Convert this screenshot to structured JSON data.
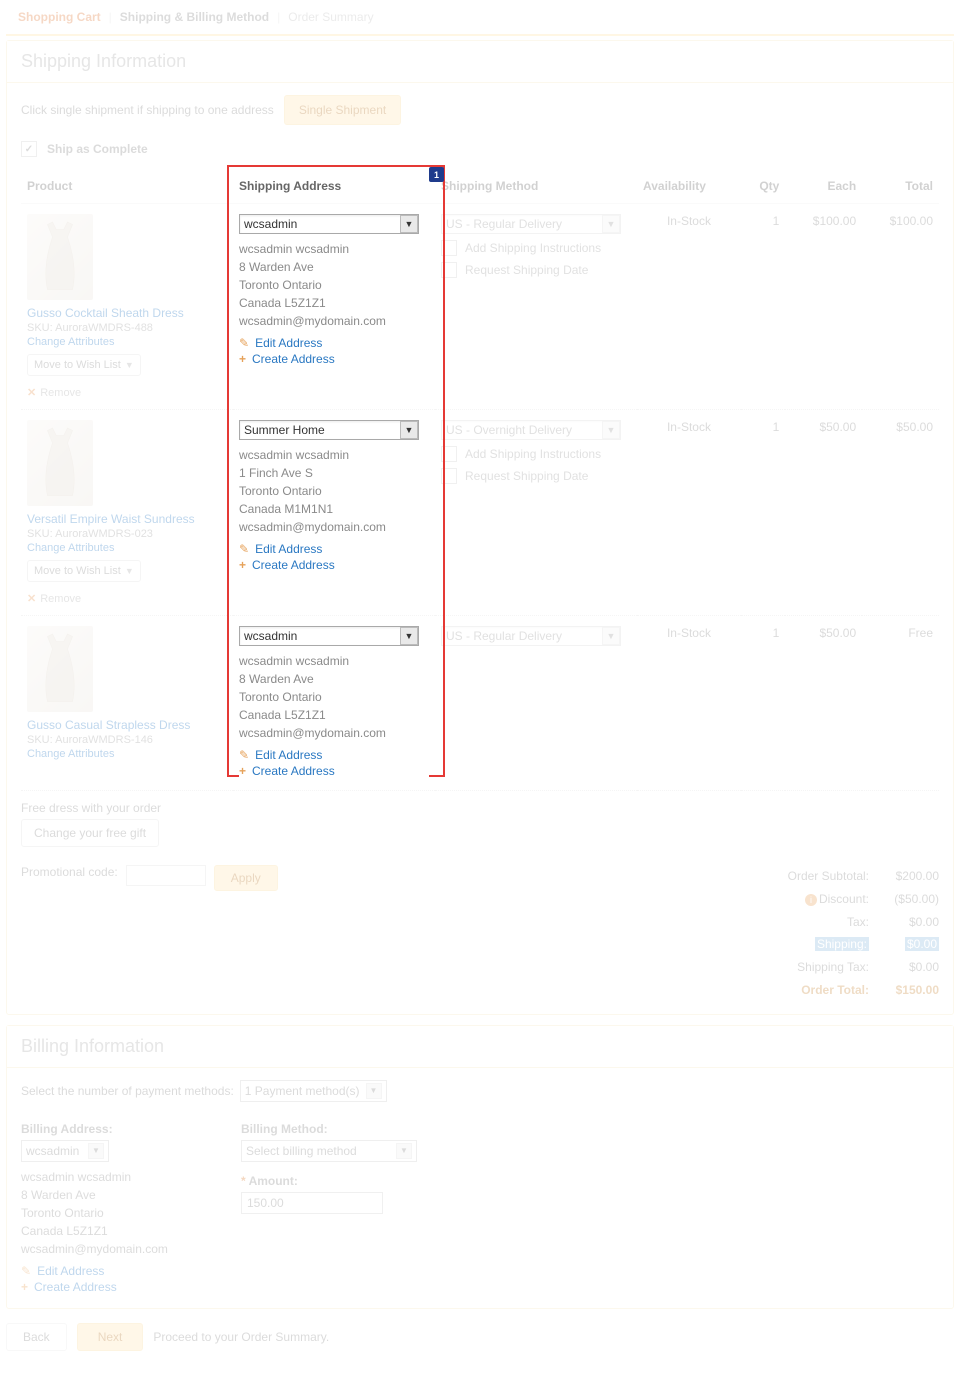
{
  "breadcrumbs": {
    "cart": "Shopping Cart",
    "ship": "Shipping & Billing Method",
    "summary": "Order Summary"
  },
  "shipping_info_header": "Shipping Information",
  "single_ship_hint": "Click single shipment if shipping to one address",
  "single_ship_btn": "Single Shipment",
  "ship_complete_label": "Ship as Complete",
  "cols": {
    "product": "Product",
    "addr": "Shipping Address",
    "method": "Shipping Method",
    "avail": "Availability",
    "qty": "Qty",
    "each": "Each",
    "total": "Total"
  },
  "remove_label": "Remove",
  "wish_label": "Move to Wish List",
  "edit_addr": "Edit Address",
  "create_addr": "Create Address",
  "add_instr": "Add Shipping Instructions",
  "req_date": "Request Shipping Date",
  "change_attr": "Change Attributes",
  "rows": [
    {
      "name": "Gusso Cocktail Sheath Dress",
      "sku": "SKU: AuroraWMDRS-488",
      "addr_sel": "wcsadmin",
      "addr": [
        "wcsadmin wcsadmin",
        "8 Warden Ave",
        "Toronto Ontario",
        "Canada L5Z1Z1",
        "wcsadmin@mydomain.com"
      ],
      "method": "US - Regular Delivery",
      "avail": "In-Stock",
      "qty": "1",
      "each": "$100.00",
      "total": "$100.00",
      "wish": true
    },
    {
      "name": "Versatil Empire Waist Sundress",
      "sku": "SKU: AuroraWMDRS-023",
      "addr_sel": "Summer Home",
      "addr": [
        "wcsadmin wcsadmin",
        "1 Finch Ave S",
        "Toronto Ontario",
        "Canada M1M1N1",
        "wcsadmin@mydomain.com"
      ],
      "method": "US - Overnight Delivery",
      "avail": "In-Stock",
      "qty": "1",
      "each": "$50.00",
      "total": "$50.00",
      "wish": true
    },
    {
      "name": "Gusso Casual Strapless Dress",
      "sku": "SKU: AuroraWMDRS-146",
      "addr_sel": "wcsadmin",
      "addr": [
        "wcsadmin wcsadmin",
        "8 Warden Ave",
        "Toronto Ontario",
        "Canada L5Z1Z1",
        "wcsadmin@mydomain.com"
      ],
      "method": "US - Regular Delivery",
      "avail": "In-Stock",
      "qty": "1",
      "each": "$50.00",
      "total": "Free",
      "wish": false
    }
  ],
  "free_gift": {
    "label": "Free dress with your order",
    "btn": "Change your free gift"
  },
  "promo": {
    "label": "Promotional code:",
    "apply": "Apply"
  },
  "totals": {
    "subtotal_l": "Order Subtotal:",
    "subtotal_v": "$200.00",
    "discount_l": "Discount:",
    "discount_v": "($50.00)",
    "tax_l": "Tax:",
    "tax_v": "$0.00",
    "ship_l": "Shipping:",
    "ship_v": "$0.00",
    "shiptax_l": "Shipping Tax:",
    "shiptax_v": "$0.00",
    "total_l": "Order Total:",
    "total_v": "$150.00"
  },
  "billing": {
    "header": "Billing Information",
    "num_label": "Select the number of payment methods:",
    "num_sel": "1 Payment method(s)",
    "addr_label": "Billing Address:",
    "addr_sel": "wcsadmin",
    "addr_lines": [
      "wcsadmin wcsadmin",
      "8 Warden Ave",
      "Toronto Ontario",
      "Canada L5Z1Z1",
      "wcsadmin@mydomain.com"
    ],
    "method_label": "Billing Method:",
    "method_sel": "Select billing method",
    "amount_label": "Amount:",
    "amount_val": "150.00"
  },
  "footer": {
    "back": "Back",
    "next": "Next",
    "hint": "Proceed to your Order Summary."
  },
  "callout": "1"
}
